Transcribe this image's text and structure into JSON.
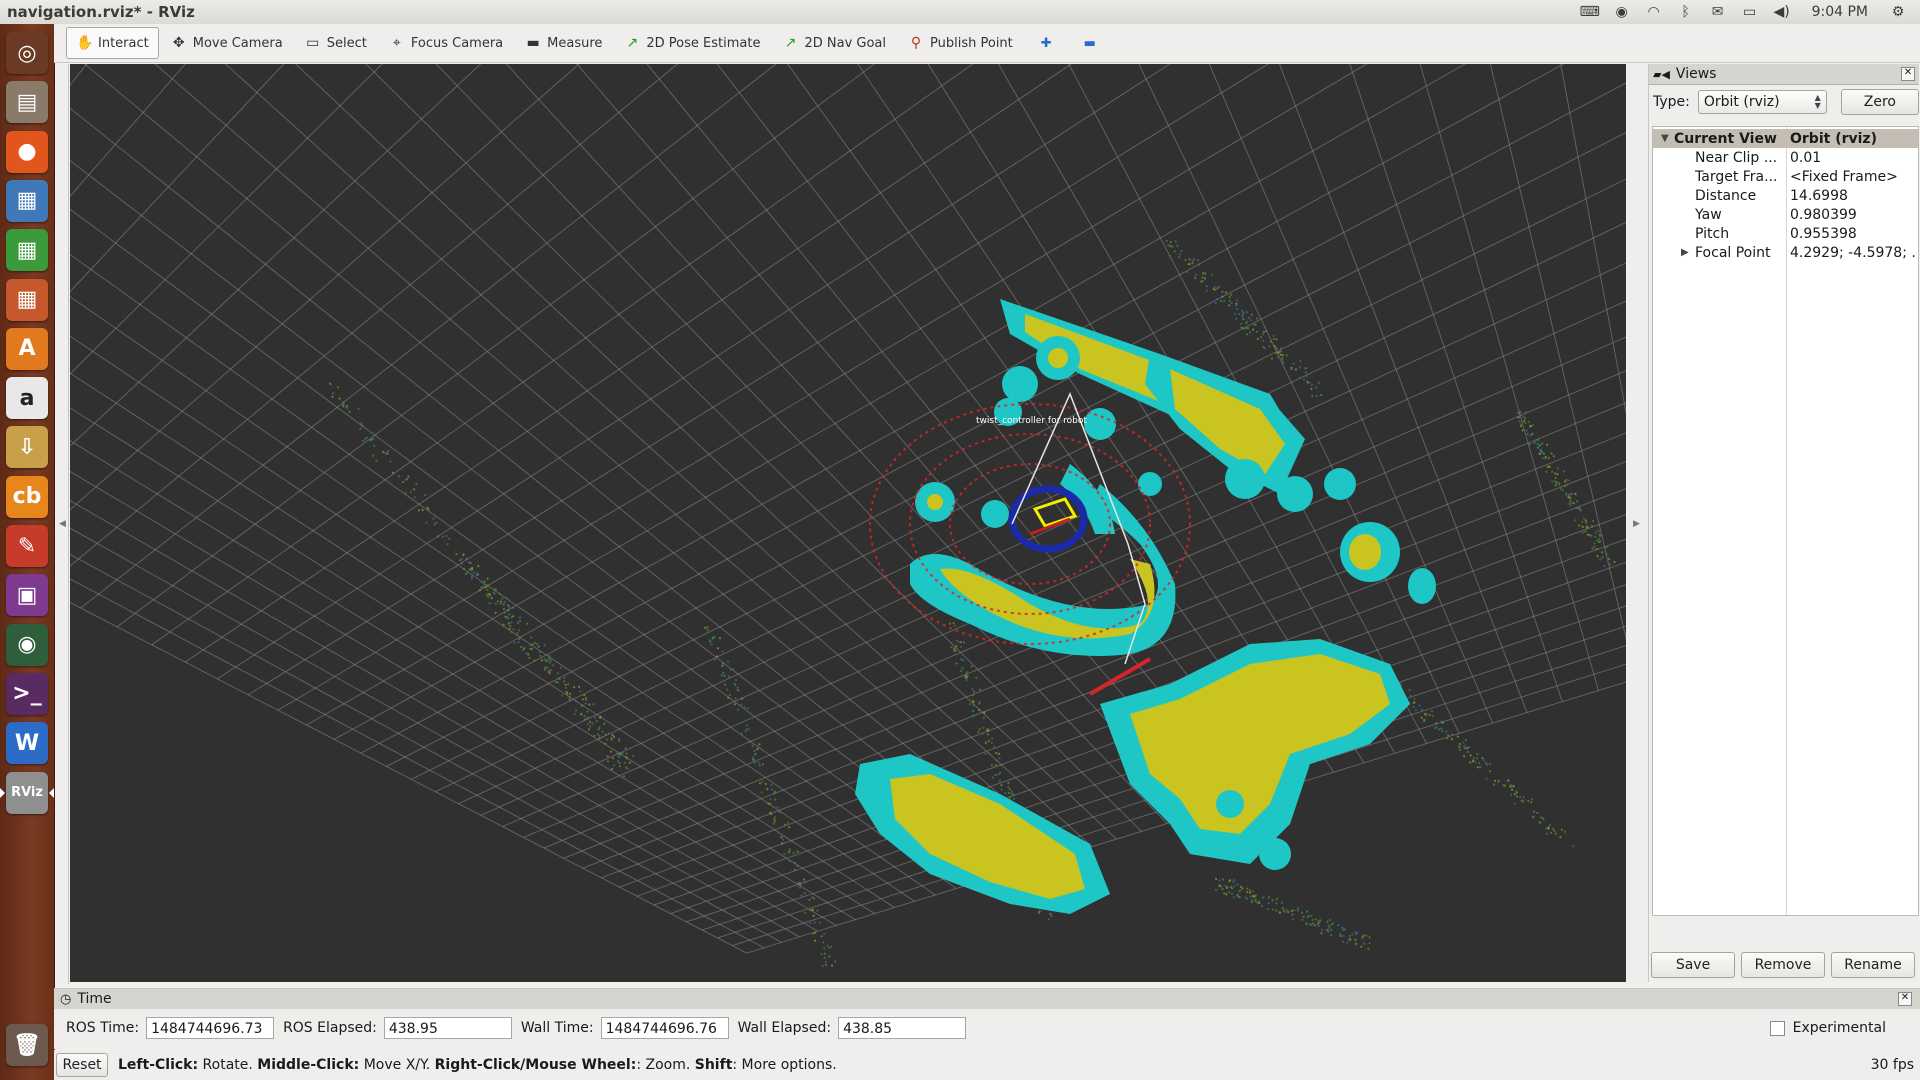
{
  "window": {
    "title": "navigation.rviz* - RViz"
  },
  "tray": {
    "clock": "9:04 PM",
    "icons": [
      "keyboard-icon",
      "chrome-icon",
      "wifi-icon",
      "bluetooth-icon",
      "mail-icon",
      "battery-icon",
      "volume-icon",
      "settings-gear-icon"
    ]
  },
  "launcher": {
    "apps": [
      {
        "name": "dash-home",
        "glyph": "◎",
        "bg": "#6b3a24"
      },
      {
        "name": "files",
        "glyph": "▤",
        "bg": "#8a7a6a"
      },
      {
        "name": "firefox",
        "glyph": "●",
        "bg": "#e1561c"
      },
      {
        "name": "writer",
        "glyph": "▦",
        "bg": "#3f79b8"
      },
      {
        "name": "calc",
        "glyph": "▦",
        "bg": "#3b9a3a"
      },
      {
        "name": "impress",
        "glyph": "▦",
        "bg": "#c5582c"
      },
      {
        "name": "software-center",
        "glyph": "A",
        "bg": "#e3791f"
      },
      {
        "name": "amazon",
        "glyph": "a",
        "bg": "#e8e8e8"
      },
      {
        "name": "archive",
        "glyph": "⇩",
        "bg": "#c9a04a"
      },
      {
        "name": "disc-burner",
        "glyph": "cb",
        "bg": "#e6861b"
      },
      {
        "name": "system-settings",
        "glyph": "✎",
        "bg": "#c63b2a"
      },
      {
        "name": "screenshot",
        "glyph": "▣",
        "bg": "#7d3a8e"
      },
      {
        "name": "webcam",
        "glyph": "◉",
        "bg": "#2f5f3a"
      },
      {
        "name": "terminal",
        "glyph": ">_",
        "bg": "#5a2a62"
      },
      {
        "name": "wps-writer",
        "glyph": "W",
        "bg": "#2c6cc7"
      },
      {
        "name": "rviz",
        "glyph": "RViz",
        "bg": "#8f8f8f"
      }
    ],
    "trash_glyph": "🗑"
  },
  "toolbar": {
    "tools": [
      {
        "name": "interact",
        "label": "Interact",
        "icon": "✋",
        "active": true
      },
      {
        "name": "move-camera",
        "label": "Move Camera",
        "icon": "✥",
        "active": false
      },
      {
        "name": "select",
        "label": "Select",
        "icon": "▭",
        "active": false
      },
      {
        "name": "focus-camera",
        "label": "Focus Camera",
        "icon": "⌖",
        "active": false
      },
      {
        "name": "measure",
        "label": "Measure",
        "icon": "▬",
        "active": false
      },
      {
        "name": "2d-pose-estimate",
        "label": "2D Pose Estimate",
        "icon": "↗",
        "active": false
      },
      {
        "name": "2d-nav-goal",
        "label": "2D Nav Goal",
        "icon": "↗",
        "active": false
      },
      {
        "name": "publish-point",
        "label": "Publish Point",
        "icon": "⚲",
        "active": false
      }
    ],
    "add_icon": "✚",
    "remove_icon": "▬"
  },
  "viewport": {
    "overlay_label": "twist_controller for robot"
  },
  "views": {
    "title": "Views",
    "type_label": "Type:",
    "type_value": "Orbit (rviz)",
    "zero_label": "Zero",
    "tree": {
      "header_name": "Current View",
      "header_value": "Orbit (rviz)",
      "rows": [
        {
          "name": "Near Clip ...",
          "value": "0.01"
        },
        {
          "name": "Target Fra...",
          "value": "<Fixed Frame>"
        },
        {
          "name": "Distance",
          "value": "14.6998"
        },
        {
          "name": "Yaw",
          "value": "0.980399"
        },
        {
          "name": "Pitch",
          "value": "0.955398"
        },
        {
          "name": "Focal Point",
          "value": "4.2929; -4.5978; ..."
        }
      ]
    },
    "save_label": "Save",
    "remove_label": "Remove",
    "rename_label": "Rename"
  },
  "time": {
    "title": "Time",
    "ros_time_label": "ROS Time:",
    "ros_time": "1484744696.73",
    "ros_elapsed_label": "ROS Elapsed:",
    "ros_elapsed": "438.95",
    "wall_time_label": "Wall Time:",
    "wall_time": "1484744696.76",
    "wall_elapsed_label": "Wall Elapsed:",
    "wall_elapsed": "438.85",
    "experimental_label": "Experimental"
  },
  "status": {
    "reset_label": "Reset",
    "left_click": "Left-Click:",
    "left_click_desc": " Rotate. ",
    "middle_click": "Middle-Click:",
    "middle_click_desc": " Move X/Y. ",
    "right_click": "Right-Click/Mouse Wheel:",
    "right_click_desc": ": Zoom. ",
    "shift": "Shift",
    "shift_desc": ": More options.",
    "fps": "30 fps"
  },
  "colors": {
    "viewport_bg": "#303030",
    "grid": "#8a8a8a",
    "costmap_outer": "#1fc6c6",
    "costmap_inner": "#c9c420",
    "laser": "#d4262a",
    "robot_ring": "#1b2aa8"
  }
}
